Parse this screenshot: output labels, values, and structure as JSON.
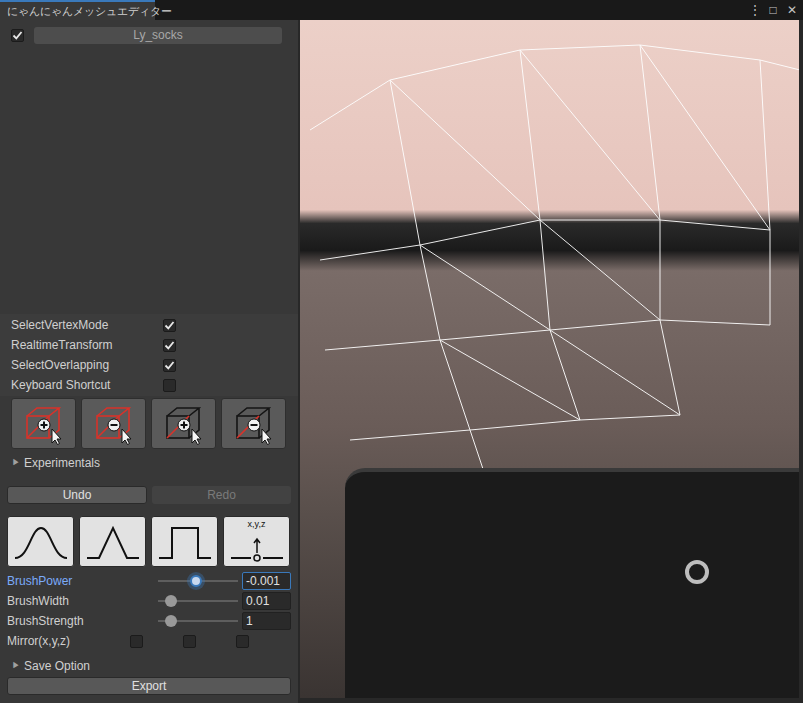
{
  "window": {
    "title": "にゃんにゃんメッシュエディター",
    "controls": [
      "⋮",
      "□",
      "✕"
    ]
  },
  "mesh": {
    "label": "Ly_socks",
    "checked": true
  },
  "toggles": [
    {
      "label": "SelectVertexMode",
      "checked": true
    },
    {
      "label": "RealtimeTransform",
      "checked": true
    },
    {
      "label": "SelectOverlapping",
      "checked": true
    },
    {
      "label": "Keyboard Shortcut",
      "checked": false
    }
  ],
  "tool_buttons": [
    {
      "kind": "red-plus"
    },
    {
      "kind": "red-minus"
    },
    {
      "kind": "black-plus"
    },
    {
      "kind": "black-minus"
    }
  ],
  "experimentals": {
    "arrow": "▶",
    "label": "Experimentals",
    "expanded": false
  },
  "undo": {
    "label": "Undo",
    "disabled": false
  },
  "redo": {
    "label": "Redo",
    "disabled": true
  },
  "brush_shapes": [
    {
      "kind": "smooth"
    },
    {
      "kind": "linear"
    },
    {
      "kind": "constant"
    },
    {
      "kind": "point",
      "label": "x,y,z"
    }
  ],
  "sliders": [
    {
      "label": "BrushPower",
      "level": 0.475,
      "value": "-0.001",
      "focused": true
    },
    {
      "label": "BrushWidth",
      "level": 0.16,
      "value": "0.01",
      "focused": false
    },
    {
      "label": "BrushStrength",
      "level": 0.16,
      "value": "1",
      "focused": false
    }
  ],
  "mirror": {
    "label": "Mirror(x,y,z)",
    "axes": [
      {
        "checked": false
      },
      {
        "checked": false
      },
      {
        "checked": false
      }
    ]
  },
  "save_option": {
    "arrow": "▶",
    "label": "Save Option",
    "expanded": false
  },
  "export": {
    "label": "Export"
  }
}
